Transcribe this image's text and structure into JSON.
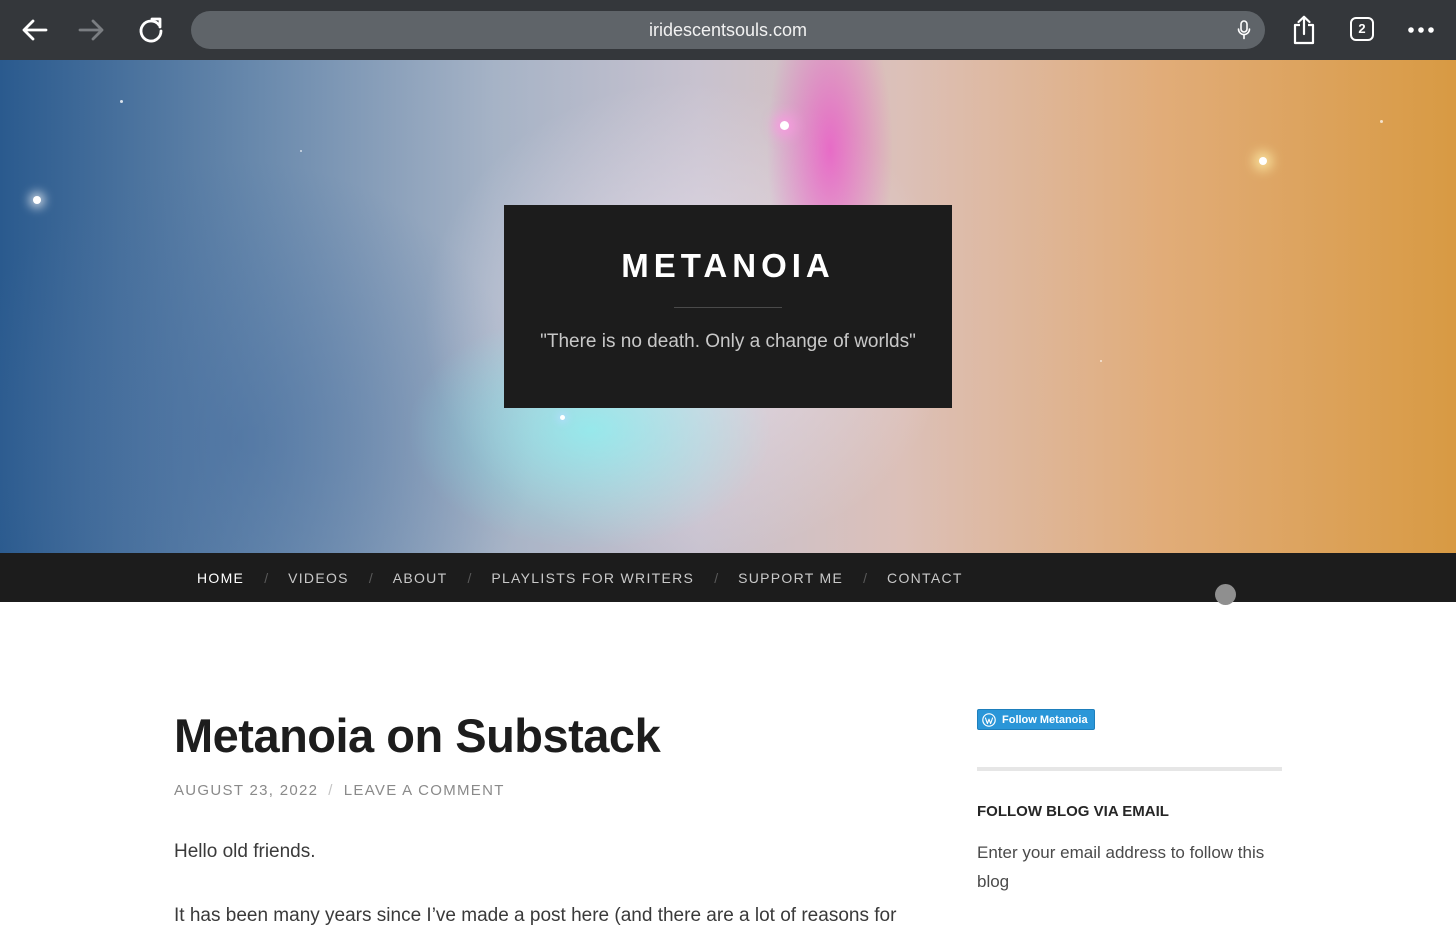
{
  "browser": {
    "url": "iridescentsouls.com",
    "tab_count": "2",
    "icons": [
      "back-arrow-icon",
      "forward-arrow-icon",
      "reload-icon",
      "microphone-icon",
      "share-icon",
      "tabs-icon",
      "more-icon"
    ]
  },
  "site": {
    "title": "METANOIA",
    "description": "\"There is no death. Only a change of worlds\""
  },
  "nav": {
    "items": [
      {
        "label": "HOME"
      },
      {
        "label": "VIDEOS"
      },
      {
        "label": "ABOUT"
      },
      {
        "label": "PLAYLISTS FOR WRITERS"
      },
      {
        "label": "SUPPORT ME"
      },
      {
        "label": "CONTACT"
      }
    ],
    "separator": "/"
  },
  "post": {
    "title": "Metanoia on Substack",
    "date": "AUGUST 23, 2022",
    "meta_separator": "/",
    "comment_link": "LEAVE A COMMENT",
    "paragraphs": [
      "Hello old friends.",
      "It has been many years since I’ve made a post here (and there are a lot of reasons for"
    ]
  },
  "sidebar": {
    "follow_button": "Follow Metanoia",
    "email_widget_title": "FOLLOW BLOG VIA EMAIL",
    "email_widget_text": "Enter your email address to follow this blog"
  },
  "colors": {
    "chrome_bg": "#34373b",
    "url_bar": "#5f6469",
    "title_box": "#1c1c1c",
    "nav_bg": "#1c1c1c",
    "follow_button": "#2a96d8"
  }
}
